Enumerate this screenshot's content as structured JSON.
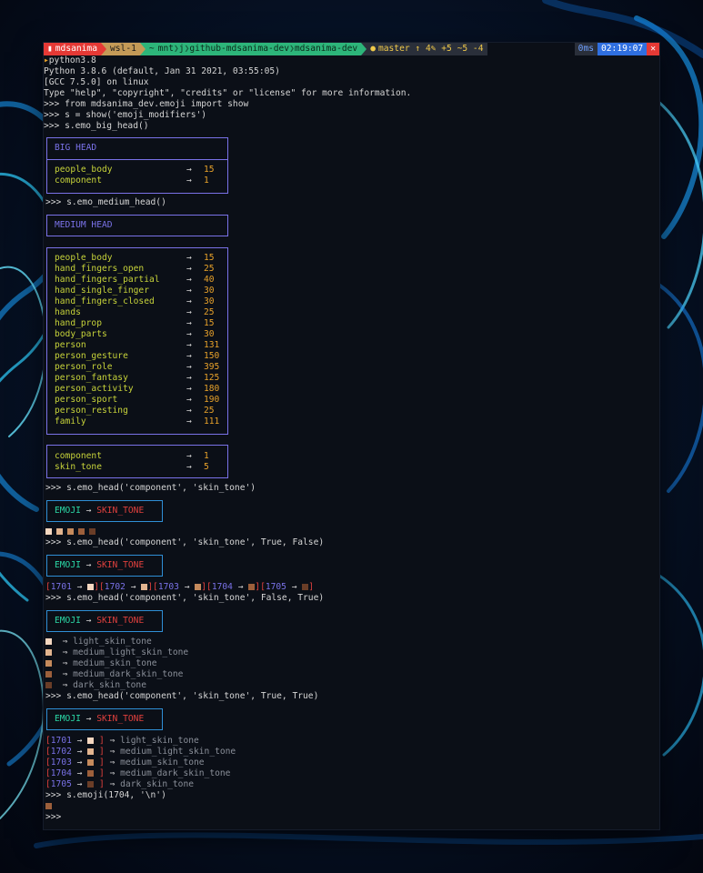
{
  "colors": {
    "tone1": "#f4d7c0",
    "tone2": "#e2b48f",
    "tone3": "#c58a5c",
    "tone4": "#9c5f3b",
    "tone5": "#6a3d27"
  },
  "prompt": {
    "user": "mdsanima",
    "host": "wsl-1",
    "path_home": "~",
    "path_1": "mnt",
    "path_2": "j",
    "path_3": "github-mdsanima-dev",
    "path_4": "mdsanima-dev",
    "git": "master ↑ 4✎ +5 ~5 -4",
    "duration": "0ms",
    "clock": "02:19:07"
  },
  "lines": {
    "l1": "python3.8",
    "l2": "Python 3.8.6 (default, Jan 31 2021, 03:55:05)",
    "l3": "[GCC 7.5.0] on linux",
    "l4": "Type \"help\", \"copyright\", \"credits\" or \"license\" for more information.",
    "l5": ">>> from mdsanima_dev.emoji import show",
    "l6": ">>> s = show('emoji_modifiers')",
    "l7": ">>> s.emo_big_head()",
    "l8": ">>> s.emo_medium_head()",
    "l9": ">>> s.emo_head('component', 'skin_tone')",
    "l10": ">>> s.emo_head('component', 'skin_tone', True, False)",
    "l11": ">>> s.emo_head('component', 'skin_tone', False, True)",
    "l12": ">>> s.emo_head('component', 'skin_tone', True, True)",
    "l13": ">>> s.emoji(1704, '\\n')",
    "l14": ">>>"
  },
  "big_head": {
    "title": "BIG HEAD",
    "rows": [
      {
        "k": "people_body",
        "v": "15"
      },
      {
        "k": "component",
        "v": "1"
      }
    ]
  },
  "medium_head": {
    "title": "MEDIUM HEAD",
    "rows": [
      {
        "k": "people_body",
        "v": "15"
      },
      {
        "k": "hand_fingers_open",
        "v": "25"
      },
      {
        "k": "hand_fingers_partial",
        "v": "40"
      },
      {
        "k": "hand_single_finger",
        "v": "30"
      },
      {
        "k": "hand_fingers_closed",
        "v": "30"
      },
      {
        "k": "hands",
        "v": "25"
      },
      {
        "k": "hand_prop",
        "v": "15"
      },
      {
        "k": "body_parts",
        "v": "30"
      },
      {
        "k": "person",
        "v": "131"
      },
      {
        "k": "person_gesture",
        "v": "150"
      },
      {
        "k": "person_role",
        "v": "395"
      },
      {
        "k": "person_fantasy",
        "v": "125"
      },
      {
        "k": "person_activity",
        "v": "180"
      },
      {
        "k": "person_sport",
        "v": "190"
      },
      {
        "k": "person_resting",
        "v": "25"
      },
      {
        "k": "family",
        "v": "111"
      }
    ],
    "rows2": [
      {
        "k": "component",
        "v": "1"
      },
      {
        "k": "skin_tone",
        "v": "5"
      }
    ]
  },
  "emoji_head": {
    "left": "EMOJI",
    "arrow": "→",
    "right": "SKIN_TONE"
  },
  "arrow": "→",
  "darrow": "⇒",
  "codes": [
    "1701",
    "1702",
    "1703",
    "1704",
    "1705"
  ],
  "tone_names": [
    "light_skin_tone",
    "medium_light_skin_tone",
    "medium_skin_tone",
    "medium_dark_skin_tone",
    "dark_skin_tone"
  ]
}
